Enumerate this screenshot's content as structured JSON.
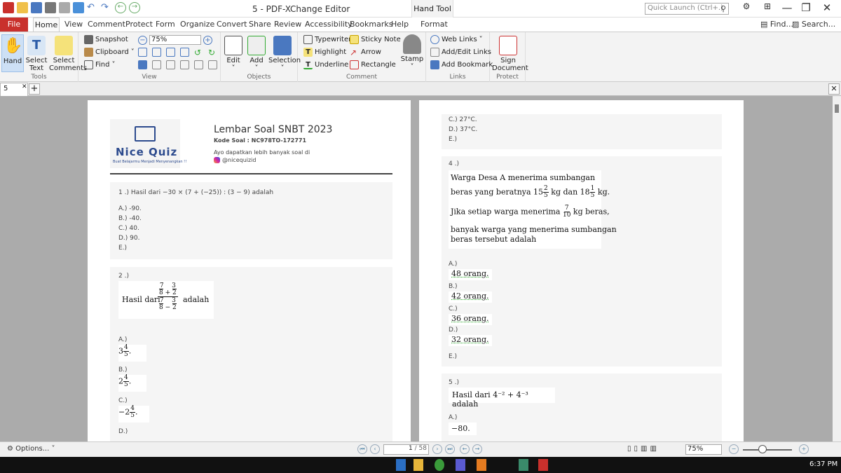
{
  "window": {
    "title": "5 - PDF-XChange Editor",
    "context_tab": "Hand Tool",
    "context_sub": "Format",
    "quick_launch": "Quick Launch (Ctrl+.)"
  },
  "menu": {
    "file": "File",
    "items": [
      "Home",
      "View",
      "Comment",
      "Protect",
      "Form",
      "Organize",
      "Convert",
      "Share",
      "Review",
      "Accessibility",
      "Bookmarks",
      "Help",
      "Format"
    ],
    "find": "Find...",
    "search": "Search..."
  },
  "ribbon": {
    "tools": {
      "label": "Tools",
      "hand": "Hand",
      "select_text": "Select Text",
      "select_comments": "Select Comments"
    },
    "view": {
      "label": "View",
      "snapshot": "Snapshot",
      "clipboard": "Clipboard",
      "find": "Find",
      "zoom": "75%"
    },
    "objects": {
      "label": "Objects",
      "edit": "Edit",
      "add": "Add",
      "selection": "Selection"
    },
    "comment": {
      "label": "Comment",
      "typewriter": "Typewriter",
      "sticky": "Sticky Note",
      "highlight": "Highlight",
      "arrow": "Arrow",
      "underline": "Underline",
      "rectangle": "Rectangle",
      "stamp": "Stamp"
    },
    "links": {
      "label": "Links",
      "web": "Web Links",
      "addedit": "Add/Edit Links",
      "bookmark": "Add Bookmark"
    },
    "protect": {
      "label": "Protect",
      "sign": "Sign Document"
    }
  },
  "tab": {
    "name": "5"
  },
  "page1": {
    "logo_name": "Nice Quiz",
    "logo_sub": "Buat Belajarmu Menjadi Menyenangkan !!",
    "title": "Lembar Soal SNBT 2023",
    "code": "Kode Soal : NC978TO-172771",
    "cta": "Ayo dapatkan lebih banyak soal di",
    "ig": "@nicequizid",
    "q1": {
      "text": "1 .) Hasil dari −30 × (7 + (−25)) : (3 − 9) adalah",
      "options": [
        "A.) -90.",
        "B.) -40.",
        "C.) 40.",
        "D.) 90.",
        "E.)"
      ]
    },
    "q2": {
      "num": "2 .)",
      "pre": "Hasil dari",
      "post": "adalah",
      "labels": [
        "A.)",
        "B.)",
        "C.)",
        "D.)"
      ]
    }
  },
  "page2": {
    "top_options": [
      "C.) 27°C.",
      "D.) 37°C.",
      "E.)"
    ],
    "q4": {
      "num": "4 .)",
      "line1": "Warga  Desa  A  menerima  sumbangan",
      "line2a": "beras yang beratnya 15",
      "line2b": "kg dan 18",
      "line2c": "kg.",
      "line3a": "Jika  setiap  warga  menerima",
      "line3b": "kg beras,",
      "line4": "banyak warga yang menerima sumbangan",
      "line5": "beras tersebut adalah",
      "labels": [
        "A.)",
        "B.)",
        "C.)",
        "D.)",
        "E.)"
      ],
      "answers": [
        "48 orang.",
        "42 orang.",
        "36 orang.",
        "32 orang."
      ]
    },
    "q5": {
      "num": "5 .)",
      "text": "Hasil dari 4⁻² + 4⁻³ adalah",
      "label_a": "A.)",
      "answer_a": "−80."
    }
  },
  "status": {
    "options": "Options...",
    "page": "1",
    "total": "/ 58",
    "zoom": "75%"
  },
  "taskbar": {
    "time": "6:37 PM"
  }
}
